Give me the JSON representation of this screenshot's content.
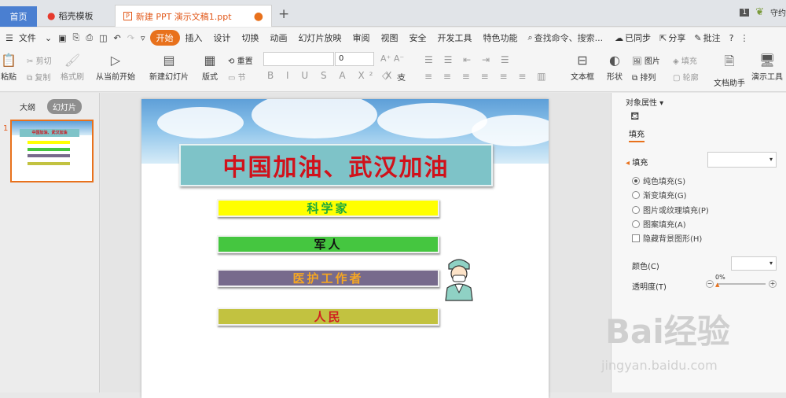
{
  "tabs": {
    "home": "首页",
    "daoke": "稻壳模板",
    "doc": "新建 PPT 演示文稿1.ppt",
    "user": "守约"
  },
  "menu": {
    "file": "文件",
    "items": [
      "开始",
      "插入",
      "设计",
      "切换",
      "动画",
      "幻灯片放映",
      "审阅",
      "视图",
      "安全",
      "开发工具",
      "特色功能"
    ],
    "search": "查找命令、搜索...",
    "sync": "已同步",
    "share": "分享",
    "comment": "批注"
  },
  "ribbon": {
    "paste": "粘贴",
    "cut": "剪切",
    "copy": "复制",
    "format_painter": "格式刷",
    "play_from_current": "从当前开始",
    "new_slide": "新建幻灯片",
    "layout": "版式",
    "reset": "重置",
    "section": "节",
    "font_size": "0",
    "textbox": "文本框",
    "shape": "形状",
    "picture": "图片",
    "arrange": "排列",
    "fill": "填充",
    "outline": "轮廓",
    "doc_helper": "文档助手",
    "present_tools": "演示工具"
  },
  "left_pane": {
    "outline_tab": "大纲",
    "slides_tab": "幻灯片",
    "slide_number": "1"
  },
  "slide": {
    "title": "中国加油、武汉加油",
    "bars": [
      {
        "text": "科学家",
        "bg": "#ffff00",
        "color": "#1faa3b"
      },
      {
        "text": "军人",
        "bg": "#45c640",
        "color": "#111111"
      },
      {
        "text": "医护工作者",
        "bg": "#776a8c",
        "color": "#f5a623"
      },
      {
        "text": "人民",
        "bg": "#c2c240",
        "color": "#d02020"
      }
    ]
  },
  "right_pane": {
    "title": "对象属性",
    "fill_tab": "填充",
    "fill_section": "填充",
    "options": [
      "纯色填充(S)",
      "渐变填充(G)",
      "图片或纹理填充(P)",
      "图案填充(A)"
    ],
    "hide_bg": "隐藏背景图形(H)",
    "color_label": "颜色(C)",
    "transparency_label": "透明度(T)",
    "transparency_value": "0%"
  },
  "watermark": {
    "brand": "Bai经验",
    "url": "jingyan.baidu.com"
  }
}
